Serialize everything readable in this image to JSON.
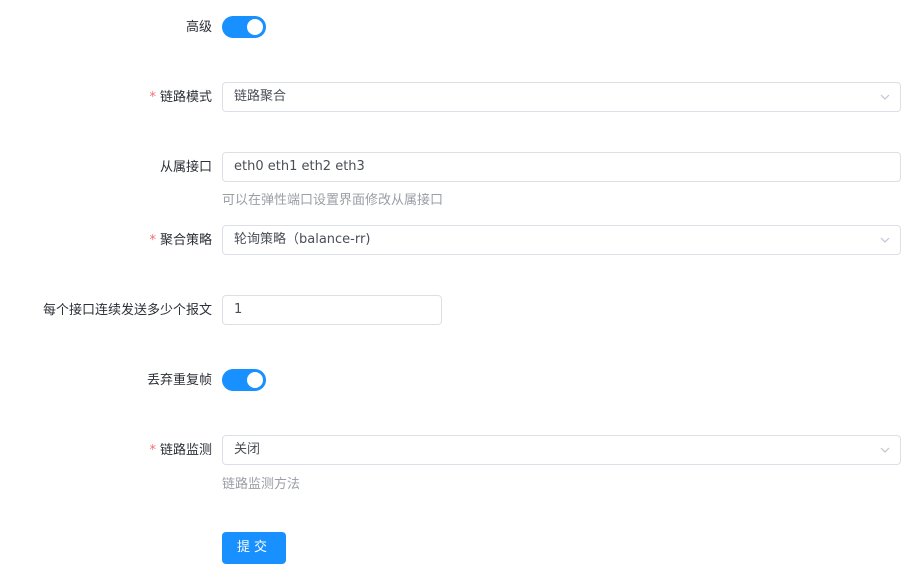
{
  "form": {
    "advanced": {
      "label": "高级",
      "enabled": true
    },
    "link_mode": {
      "label": "链路模式",
      "required": true,
      "value": "链路聚合"
    },
    "slave_interfaces": {
      "label": "从属接口",
      "value": "eth0 eth1 eth2 eth3",
      "hint": "可以在弹性端口设置界面修改从属接口"
    },
    "aggregation_policy": {
      "label": "聚合策略",
      "required": true,
      "value": "轮询策略（balance-rr)"
    },
    "packets_per_interface": {
      "label": "每个接口连续发送多少个报文",
      "value": "1"
    },
    "drop_duplicate_frames": {
      "label": "丢弃重复帧",
      "enabled": true
    },
    "link_monitor": {
      "label": "链路监测",
      "required": true,
      "value": "关闭",
      "hint": "链路监测方法"
    },
    "submit": {
      "label": "提交"
    }
  },
  "colors": {
    "primary": "#1890ff",
    "required": "#f56c6c",
    "border": "#dcdfe6",
    "hint": "#9a9ea5"
  },
  "icons": {
    "select_arrow": "chevron-down-icon",
    "required_mark": "asterisk"
  }
}
